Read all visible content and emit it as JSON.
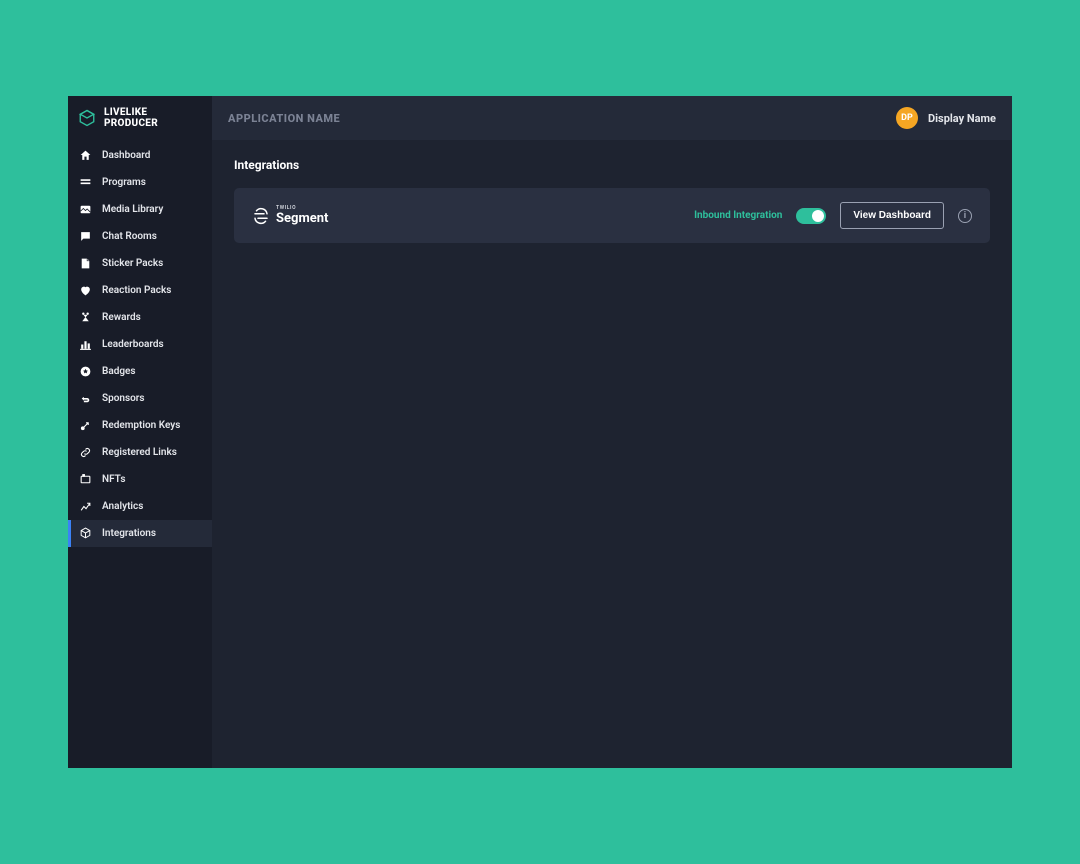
{
  "brand": {
    "label": "LIVELIKE PRODUCER"
  },
  "topbar": {
    "app_name": "APPLICATION NAME",
    "user_initials": "DP",
    "user_name": "Display Name"
  },
  "sidebar": {
    "items": [
      {
        "label": "Dashboard",
        "icon": "home-icon"
      },
      {
        "label": "Programs",
        "icon": "programs-icon"
      },
      {
        "label": "Media Library",
        "icon": "media-icon"
      },
      {
        "label": "Chat Rooms",
        "icon": "chat-icon"
      },
      {
        "label": "Sticker Packs",
        "icon": "sticker-icon"
      },
      {
        "label": "Reaction Packs",
        "icon": "reaction-icon"
      },
      {
        "label": "Rewards",
        "icon": "rewards-icon"
      },
      {
        "label": "Leaderboards",
        "icon": "leaderboard-icon"
      },
      {
        "label": "Badges",
        "icon": "badges-icon"
      },
      {
        "label": "Sponsors",
        "icon": "sponsors-icon"
      },
      {
        "label": "Redemption Keys",
        "icon": "keys-icon"
      },
      {
        "label": "Registered Links",
        "icon": "links-icon"
      },
      {
        "label": "NFTs",
        "icon": "nfts-icon"
      },
      {
        "label": "Analytics",
        "icon": "analytics-icon"
      },
      {
        "label": "Integrations",
        "icon": "integrations-icon",
        "active": true
      }
    ]
  },
  "page": {
    "title": "Integrations"
  },
  "integration": {
    "vendor_sub": "TWILIO",
    "vendor_name": "Segment",
    "inbound_label": "Inbound Integration",
    "toggle_on": true,
    "view_button": "View Dashboard",
    "info_glyph": "i"
  }
}
